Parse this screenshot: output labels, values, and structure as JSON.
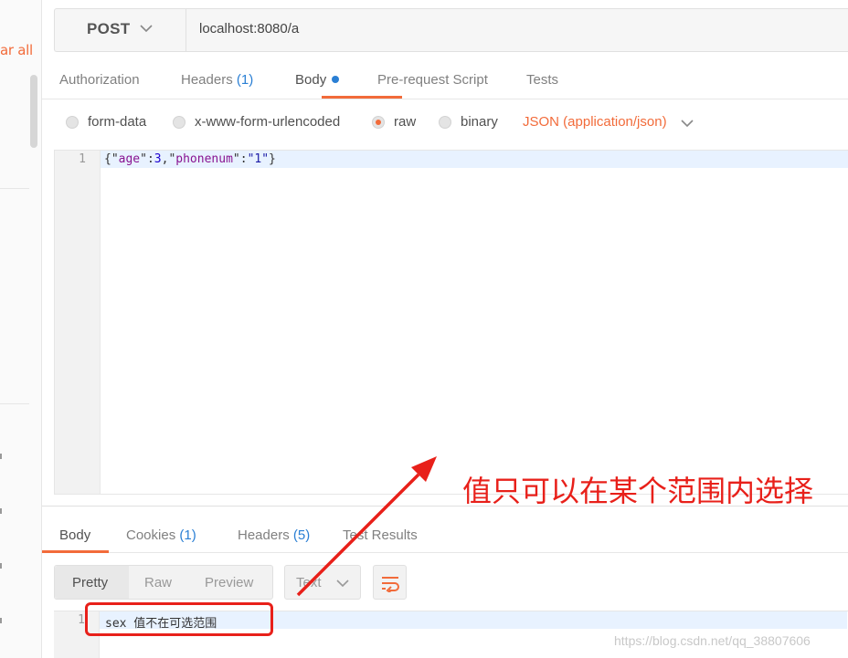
{
  "sidebar": {
    "clear_all": "ar all"
  },
  "request": {
    "method": "POST",
    "url": "localhost:8080/a",
    "tabs": [
      {
        "label": "Authorization",
        "count": ""
      },
      {
        "label": "Headers",
        "count": "(1)"
      },
      {
        "label": "Body",
        "count": ""
      },
      {
        "label": "Pre-request Script",
        "count": ""
      },
      {
        "label": "Tests",
        "count": ""
      }
    ],
    "body_types": [
      "form-data",
      "x-www-form-urlencoded",
      "raw",
      "binary"
    ],
    "selected_body_type": "raw",
    "content_type": "JSON (application/json)",
    "editor": {
      "line_number": "1",
      "code_parts": [
        "{\"",
        "age",
        "\":",
        "3",
        ",\"",
        "phonenum",
        "\":",
        "\"1\"",
        "}"
      ]
    }
  },
  "response": {
    "tabs": [
      {
        "label": "Body",
        "count": ""
      },
      {
        "label": "Cookies",
        "count": "(1)"
      },
      {
        "label": "Headers",
        "count": "(5)"
      },
      {
        "label": "Test Results",
        "count": ""
      }
    ],
    "formats": [
      "Pretty",
      "Raw",
      "Preview"
    ],
    "view_type": "Text",
    "editor": {
      "line_number": "1",
      "code": "sex 值不在可选范围"
    }
  },
  "annotation": {
    "text": "值只可以在某个范围内选择"
  },
  "watermark": "https://blog.csdn.net/qq_38807606",
  "colors": {
    "accent": "#f26b3a",
    "count_blue": "#2a7fd4",
    "annotation_red": "#e8201a"
  }
}
